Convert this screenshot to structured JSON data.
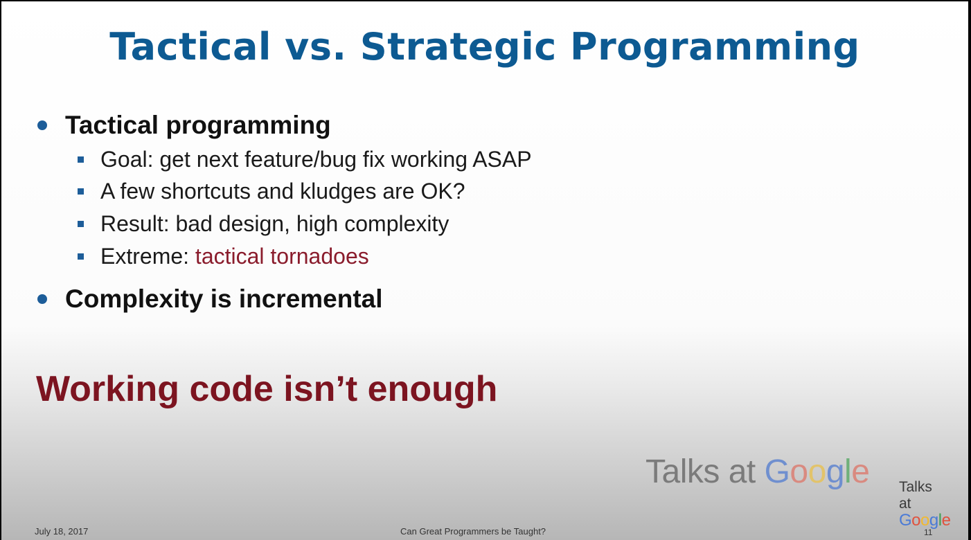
{
  "slide": {
    "title": "Tactical vs. Strategic Programming",
    "bullets": [
      {
        "text": "Tactical programming",
        "subitems": [
          {
            "text": "Goal: get next feature/bug fix working ASAP"
          },
          {
            "text": "A few shortcuts and kludges are OK?"
          },
          {
            "text": "Result: bad design, high complexity"
          },
          {
            "prefix": "Extreme: ",
            "highlight": "tactical tornadoes"
          }
        ]
      },
      {
        "text": "Complexity is incremental"
      }
    ],
    "banner": "Working code isn’t enough",
    "footer": {
      "date": "July 18, 2017",
      "title": "Can Great Programmers be Taught?",
      "page": "11"
    }
  },
  "watermark": {
    "large": {
      "talks_at": "Talks at",
      "brand_letters": [
        "G",
        "o",
        "o",
        "g",
        "l",
        "e"
      ]
    },
    "corner": {
      "line1": "Talks",
      "line2": "at",
      "brand_letters": [
        "G",
        "o",
        "o",
        "g",
        "l",
        "e"
      ]
    }
  },
  "colors": {
    "title": "#0d5a92",
    "bullet_marker": "#1d5d99",
    "emphasis": "#8a1c2c",
    "banner": "#7c1420"
  }
}
